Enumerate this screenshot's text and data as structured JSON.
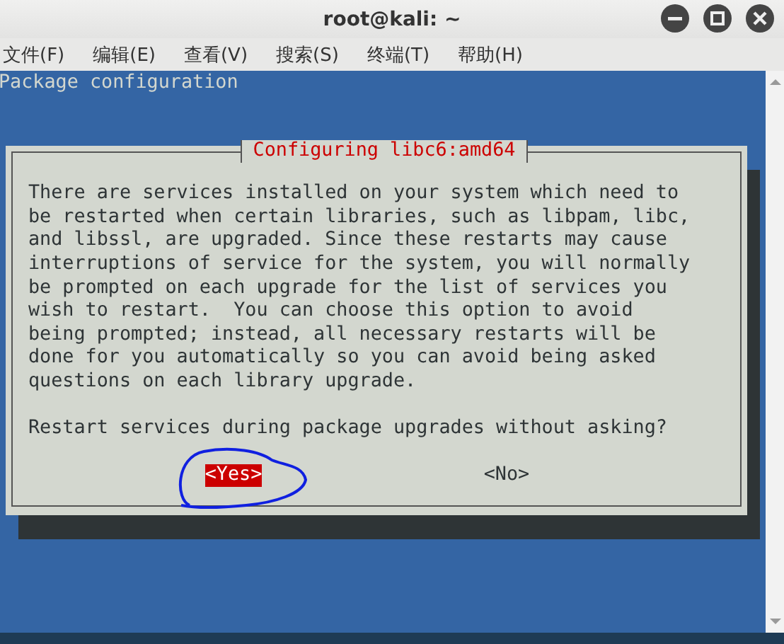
{
  "window": {
    "title": "root@kali: ~"
  },
  "menu": [
    "文件(F)",
    "编辑(E)",
    "查看(V)",
    "搜索(S)",
    "终端(T)",
    "帮助(H)"
  ],
  "terminal": {
    "heading": "Package configuration",
    "dialog": {
      "title": "Configuring libc6:amd64",
      "message": "There are services installed on your system which need to\nbe restarted when certain libraries, such as libpam, libc,\nand libssl, are upgraded. Since these restarts may cause\ninterruptions of service for the system, you will normally\nbe prompted on each upgrade for the list of services you\nwish to restart.  You can choose this option to avoid\nbeing prompted; instead, all necessary restarts will be\ndone for you automatically so you can avoid being asked\nquestions on each library upgrade.",
      "question": "Restart services during package upgrades without asking?",
      "buttons": [
        {
          "label": "<Yes>",
          "selected": true
        },
        {
          "label": "<No>",
          "selected": false
        }
      ]
    }
  }
}
